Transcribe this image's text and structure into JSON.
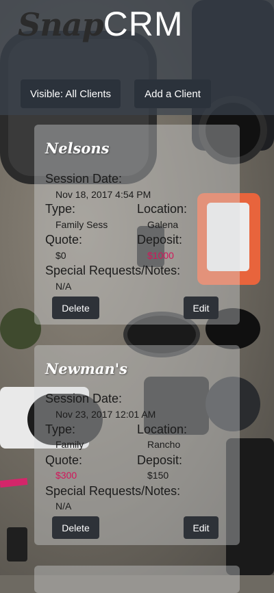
{
  "header": {
    "logo_script": "Snap",
    "logo_text": "CRM",
    "visible_button": "Visible: All Clients",
    "add_button": "Add a Client"
  },
  "labels": {
    "session_date": "Session Date:",
    "type": "Type:",
    "location": "Location:",
    "quote": "Quote:",
    "deposit": "Deposit:",
    "special": "Special Requests/Notes:",
    "delete": "Delete",
    "edit": "Edit"
  },
  "clients": [
    {
      "name": "Nelsons",
      "session_date": "Nov 18, 2017 4:54 PM",
      "type": "Family Sess",
      "location": "Galena",
      "quote": "$0",
      "deposit": "$1000",
      "notes": "N/A"
    },
    {
      "name": "Newman's",
      "session_date": "Nov 23, 2017 12:01 AM",
      "type": "Family",
      "location": "Rancho",
      "quote": "$300",
      "deposit": "$150",
      "notes": "N/A"
    }
  ],
  "colors": {
    "header_overlay": "#3a424e",
    "button_dark": "#2b323b",
    "accent_red": "#d2155a",
    "card_overlay": "#dadce0"
  }
}
